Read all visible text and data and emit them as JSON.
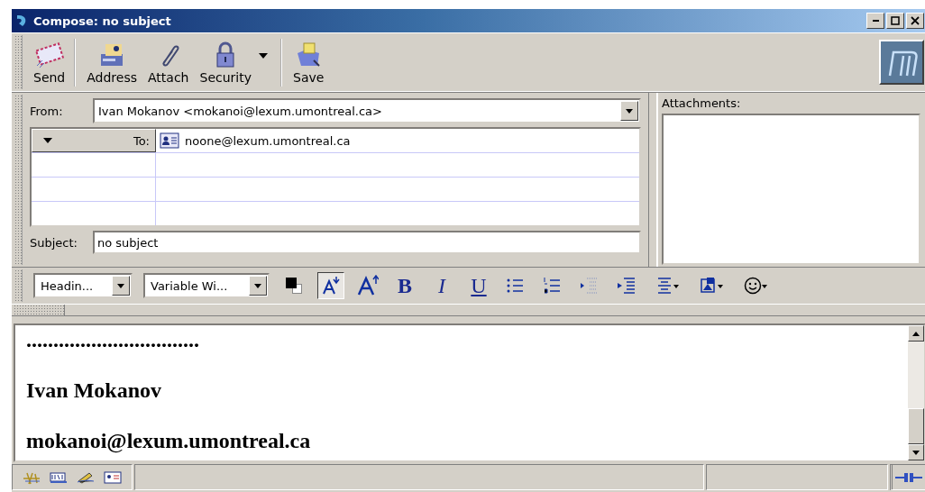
{
  "window": {
    "title": "Compose: no subject"
  },
  "toolbar": {
    "buttons": [
      {
        "kind": "send",
        "label": "Send",
        "menu": false,
        "separator_after": true
      },
      {
        "kind": "address",
        "label": "Address",
        "menu": false,
        "separator_after": false
      },
      {
        "kind": "attach",
        "label": "Attach",
        "menu": false,
        "separator_after": false
      },
      {
        "kind": "security",
        "label": "Security",
        "menu": true,
        "separator_after": true
      },
      {
        "kind": "save",
        "label": "Save",
        "menu": false,
        "separator_after": false
      }
    ]
  },
  "header": {
    "from_label": "From:",
    "from_value": "Ivan Mokanov <mokanoi@lexum.umontreal.ca>",
    "recipients": [
      {
        "type": "To:",
        "address": "noone@lexum.umontreal.ca"
      }
    ],
    "subject_label": "Subject:",
    "subject_value": "no subject",
    "attachments_label": "Attachments:"
  },
  "format_toolbar": {
    "paragraph_style": "Headin...",
    "font": "Variable Wi...",
    "buttons": [
      {
        "kind": "color",
        "selected": false
      },
      {
        "kind": "smaller",
        "selected": true
      },
      {
        "kind": "larger",
        "selected": false
      },
      {
        "kind": "bold",
        "label": "B",
        "selected": false
      },
      {
        "kind": "italic",
        "label": "I",
        "selected": false
      },
      {
        "kind": "underline",
        "label": "U",
        "selected": false
      },
      {
        "kind": "bullets",
        "selected": false
      },
      {
        "kind": "numbers",
        "selected": false
      },
      {
        "kind": "outdent",
        "selected": false
      },
      {
        "kind": "indent",
        "selected": false
      },
      {
        "kind": "align",
        "selected": false
      },
      {
        "kind": "insert",
        "selected": false
      },
      {
        "kind": "smiley",
        "selected": false
      }
    ]
  },
  "body": {
    "lines": [
      {
        "text": "................................"
      },
      {
        "text": "Ivan Mokanov"
      },
      {
        "text": "mokanoi@lexum.umontreal.ca"
      }
    ]
  },
  "status_bar": {
    "icons": [
      {
        "kind": "tools"
      },
      {
        "kind": "compose"
      },
      {
        "kind": "edit"
      },
      {
        "kind": "card"
      }
    ]
  }
}
